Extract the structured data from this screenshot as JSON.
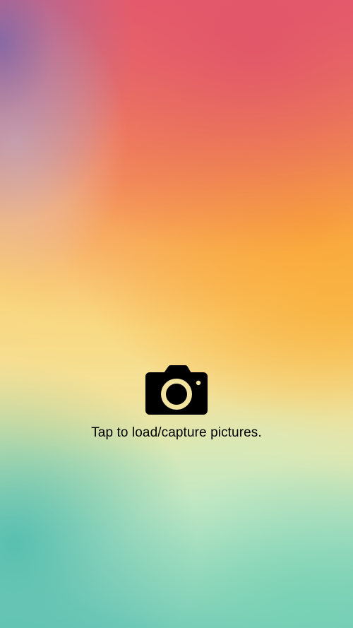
{
  "screen": {
    "caption": "Tap to load/capture pictures.",
    "icon": "camera-icon"
  },
  "colors": {
    "icon": "#000000",
    "text": "#000000",
    "lens_ring": "#f2e3a0"
  }
}
